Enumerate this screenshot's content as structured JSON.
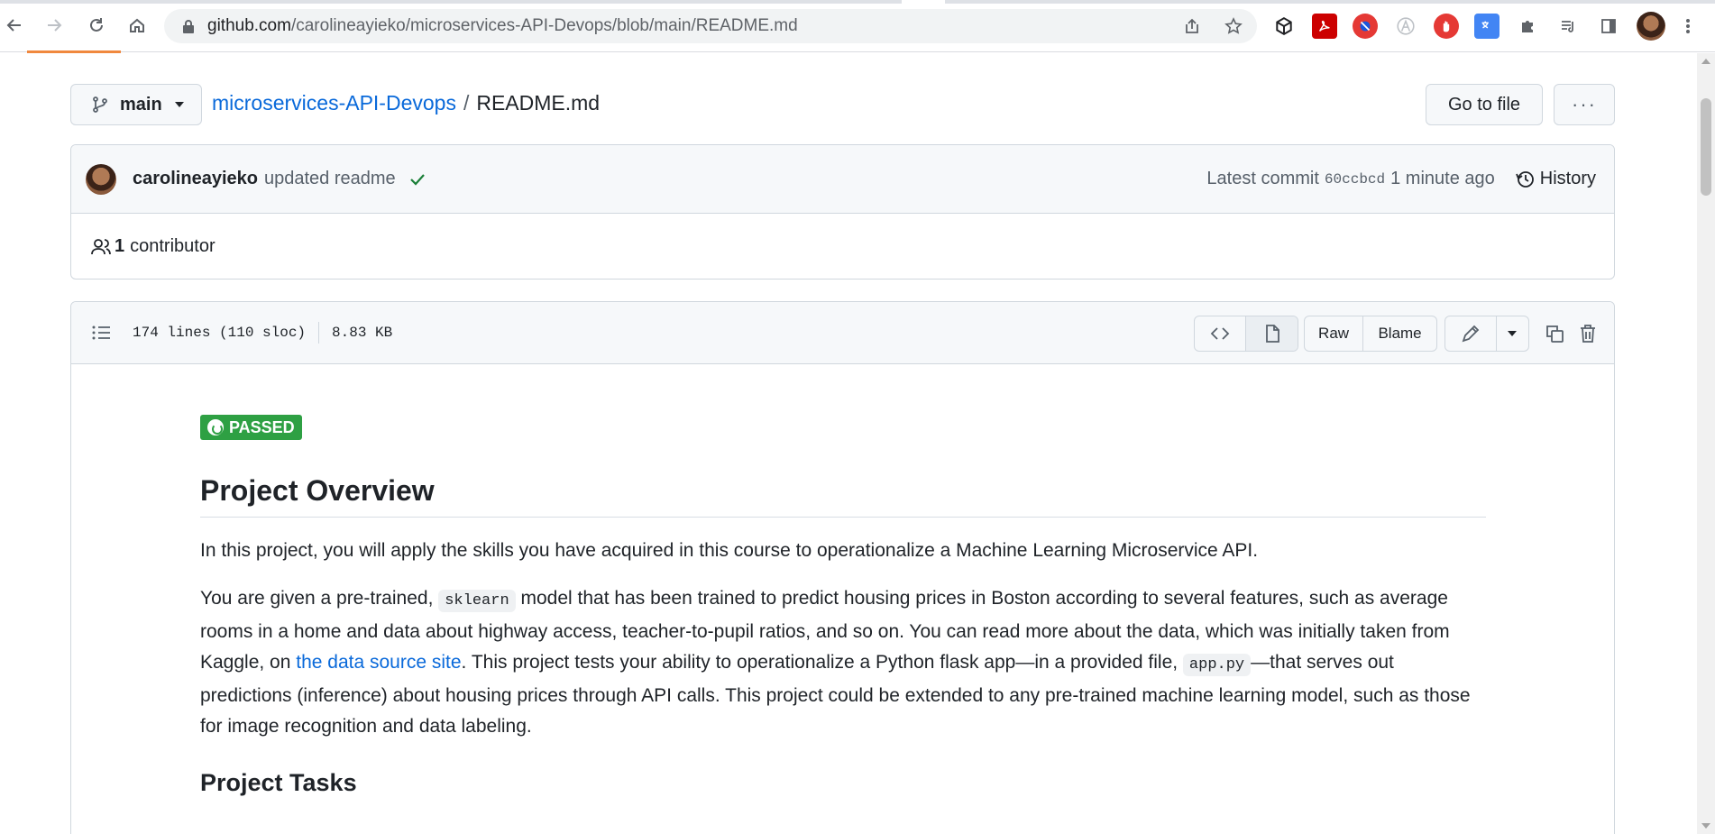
{
  "browser": {
    "url_host": "github.com",
    "url_path": "/carolineayieko/microservices-API-Devops/blob/main/README.md"
  },
  "repo_header": {
    "branch": "main",
    "repo_name": "microservices-API-Devops",
    "separator": "/",
    "file_name": "README.md",
    "goto_file_label": "Go to file",
    "more_label": "···"
  },
  "commit": {
    "author": "carolineayieko",
    "message": "updated readme",
    "latest_label": "Latest commit",
    "sha": "60ccbcd",
    "time": "1 minute ago",
    "history_label": "History"
  },
  "contributors": {
    "count": "1",
    "label": "contributor"
  },
  "file": {
    "lines": "174 lines (110 sloc)",
    "size": "8.83 KB",
    "raw_label": "Raw",
    "blame_label": "Blame"
  },
  "readme": {
    "badge": "PASSED",
    "h1": "Project Overview",
    "p1": "In this project, you will apply the skills you have acquired in this course to operationalize a Machine Learning Microservice API.",
    "p2_a": "You are given a pre-trained, ",
    "p2_code1": "sklearn",
    "p2_b": " model that has been trained to predict housing prices in Boston according to several features, such as average rooms in a home and data about highway access, teacher-to-pupil ratios, and so on. You can read more about the data, which was initially taken from Kaggle, on ",
    "p2_link": "the data source site",
    "p2_c": ". This project tests your ability to operationalize a Python flask app—in a provided file, ",
    "p2_code2": "app.py",
    "p2_d": "—that serves out predictions (inference) about housing prices through API calls. This project could be extended to any pre-trained machine learning model, such as those for image recognition and data labeling.",
    "h2": "Project Tasks"
  },
  "colors": {
    "link": "#0969da",
    "badge_green": "#2ea043",
    "check_green": "#1a7f37"
  }
}
